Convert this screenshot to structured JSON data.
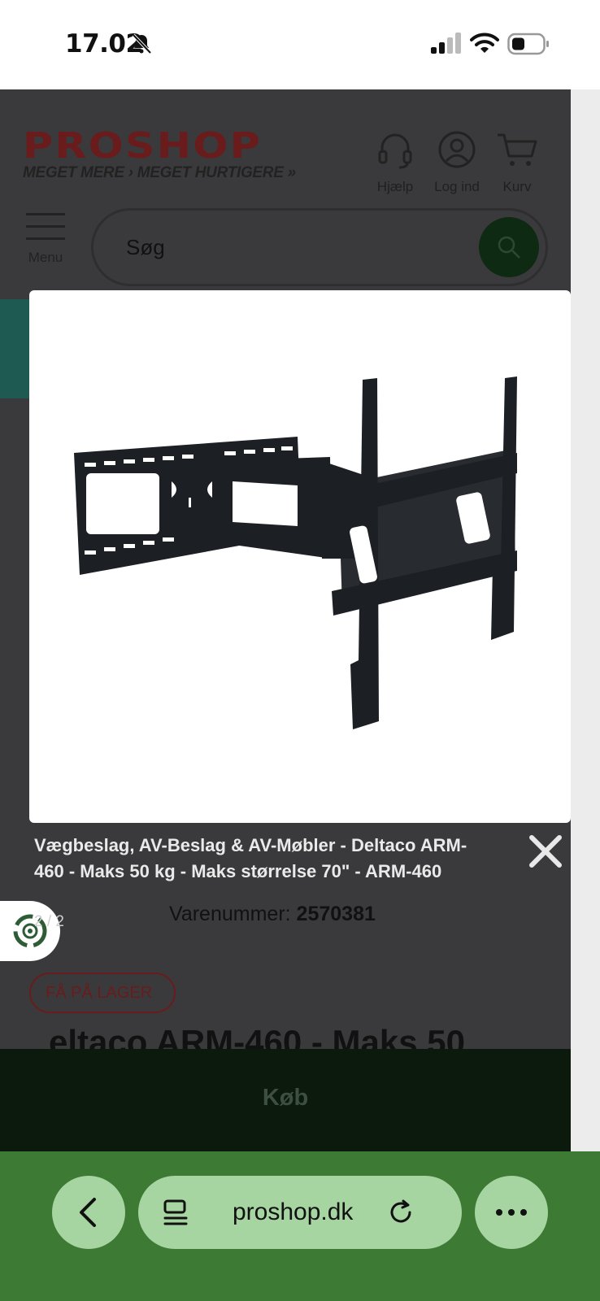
{
  "status_bar": {
    "time": "17.02"
  },
  "header": {
    "logo_text": "PROSHOP",
    "tagline": "MEGET MERE › MEGET HURTIGERE »",
    "help_label": "Hjælp",
    "login_label": "Log ind",
    "cart_label": "Kurv",
    "menu_label": "Menu",
    "search_placeholder": "Søg"
  },
  "product": {
    "sku_label": "Varenummer:",
    "sku": "2570381",
    "stock_badge": "FÅ PÅ LAGER",
    "title_partial": "eltaco ARM-460 - Maks 50",
    "buy_label": "Køb"
  },
  "lightbox": {
    "caption": "Vægbeslag, AV-Beslag & AV-Møbler - Deltaco ARM-460 - Maks 50 kg - Maks størrelse 70\" - ARM-460",
    "counter": "2 / 2",
    "image_icon": "tv-wall-mount-image",
    "close_icon": "close-icon"
  },
  "browser": {
    "url": "proshop.dk"
  },
  "colors": {
    "overlay": "#3a3a3c",
    "brand_red": "#6a1b1b",
    "browser_bar": "#3d7a34",
    "browser_pill": "#a7d5a2"
  }
}
